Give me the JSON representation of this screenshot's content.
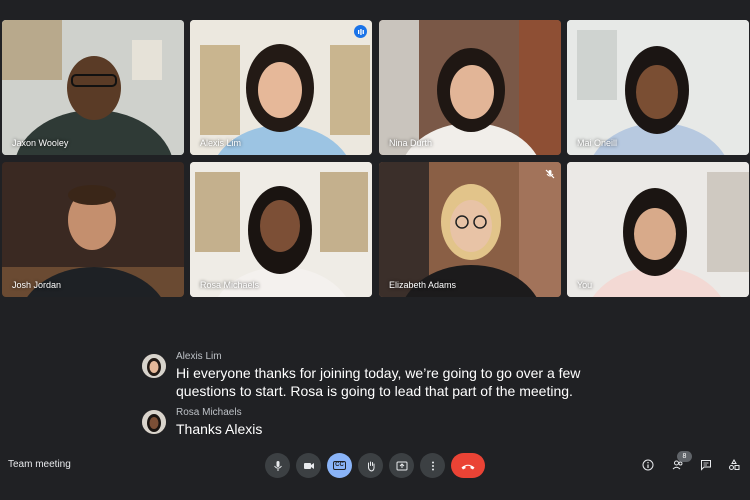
{
  "tiles": [
    {
      "name": "Jaxon Wooley",
      "indicator": "none"
    },
    {
      "name": "Alexis Lim",
      "indicator": "speaking"
    },
    {
      "name": "Nina Durth",
      "indicator": "none"
    },
    {
      "name": "Mai Oneill",
      "indicator": "none"
    },
    {
      "name": "Josh Jordan",
      "indicator": "none"
    },
    {
      "name": "Rosa Michaels",
      "indicator": "none"
    },
    {
      "name": "Elizabeth Adams",
      "indicator": "muted"
    },
    {
      "name": "You",
      "indicator": "none"
    }
  ],
  "captions": [
    {
      "speaker": "Alexis Lim",
      "text": "Hi everyone thanks for joining today, we’re going to go over a few questions to start. Rosa is going to lead that part of the meeting."
    },
    {
      "speaker": "Rosa Michaels",
      "text": "Thanks Alexis"
    }
  ],
  "bottom_bar": {
    "meeting_title": "Team meeting",
    "controls": [
      "microphone-icon",
      "camera-icon",
      "closed-captions-icon",
      "raise-hand-icon",
      "present-screen-icon",
      "more-options-icon",
      "end-call-icon"
    ],
    "captions_label": "CC",
    "right_icons": [
      "info-icon",
      "people-icon",
      "chat-icon",
      "activities-icon"
    ],
    "participant_count": "8"
  },
  "colors": {
    "background": "#202124",
    "speaking_badge": "#1a73e8",
    "captions_active": "#8ab4f8",
    "end_call": "#ea4335"
  }
}
